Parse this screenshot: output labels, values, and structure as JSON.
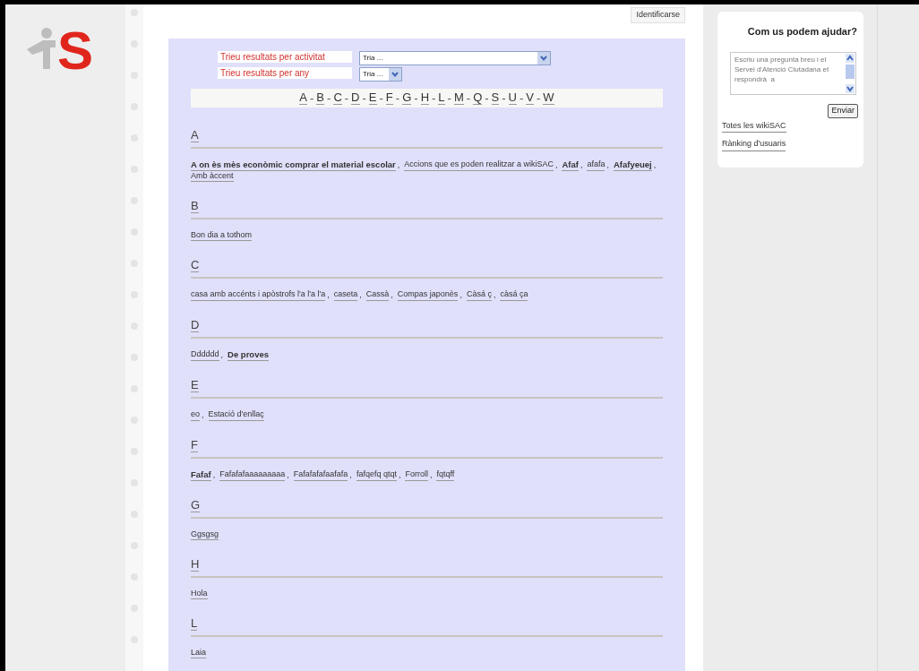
{
  "logo": {
    "text": "S"
  },
  "login_button": "Identificarse",
  "filters": [
    {
      "label": "Trieu resultats per activitat",
      "value": "Tria ...",
      "kind": "wide"
    },
    {
      "label": "Trieu resultats per any",
      "value": "Tria ...",
      "kind": "narrow"
    }
  ],
  "alphabet": [
    {
      "letter": "A",
      "suffix": "-"
    },
    {
      "letter": "B",
      "suffix": "-"
    },
    {
      "letter": "C",
      "suffix": "-"
    },
    {
      "letter": "D",
      "suffix": "-"
    },
    {
      "letter": "E",
      "suffix": "-"
    },
    {
      "letter": "F",
      "suffix": "-"
    },
    {
      "letter": "G",
      "suffix": "-"
    },
    {
      "letter": "H",
      "suffix": "-"
    },
    {
      "letter": "L",
      "suffix": "-"
    },
    {
      "letter": "M",
      "suffix": "-"
    },
    {
      "letter": "Q",
      "suffix": "-"
    },
    {
      "letter": "S",
      "suffix": "-"
    },
    {
      "letter": "U",
      "suffix": "-"
    },
    {
      "letter": "V",
      "suffix": "-"
    },
    {
      "letter": "W"
    }
  ],
  "sections": [
    {
      "letter": "A",
      "items": [
        {
          "text": "A on ès mès econòmic comprar el material escolar",
          "bold": true,
          "suffix": ","
        },
        {
          "text": "Accions que es poden realitzar a wikiSAC",
          "bold": false,
          "suffix": ","
        },
        {
          "text": "Afaf",
          "bold": true,
          "suffix": ","
        },
        {
          "text": "afafa",
          "bold": false,
          "suffix": ","
        },
        {
          "text": "Afafyeuej",
          "bold": true,
          "suffix": ","
        },
        {
          "text": "Amb àccent",
          "bold": false
        }
      ]
    },
    {
      "letter": "B",
      "items": [
        {
          "text": "Bon dia a tothom",
          "bold": false
        }
      ]
    },
    {
      "letter": "C",
      "items": [
        {
          "text": "casa amb accénts i apòstrofs l'a l'a l'a",
          "bold": false,
          "suffix": ","
        },
        {
          "text": "caseta",
          "bold": false,
          "suffix": ","
        },
        {
          "text": "Cassà",
          "bold": false,
          "suffix": ","
        },
        {
          "text": "Compas japonès",
          "bold": false,
          "suffix": ","
        },
        {
          "text": "Càsá ç",
          "bold": false,
          "suffix": ","
        },
        {
          "text": "càsá ça",
          "bold": false
        }
      ]
    },
    {
      "letter": "D",
      "items": [
        {
          "text": "Dddddd",
          "bold": false,
          "suffix": ","
        },
        {
          "text": "De proves",
          "bold": true
        }
      ]
    },
    {
      "letter": "E",
      "items": [
        {
          "text": "eo",
          "bold": false,
          "suffix": ","
        },
        {
          "text": "Estació d'enllaç",
          "bold": false
        }
      ]
    },
    {
      "letter": "F",
      "items": [
        {
          "text": "Fafaf",
          "bold": true,
          "suffix": ","
        },
        {
          "text": "Fafafafaaaaaaaaa",
          "bold": false,
          "suffix": ","
        },
        {
          "text": "Fafafafafaafafa",
          "bold": false,
          "suffix": ","
        },
        {
          "text": "fafqefq qtqt",
          "bold": false,
          "suffix": ","
        },
        {
          "text": "Forroll",
          "bold": false,
          "suffix": ","
        },
        {
          "text": "fqtqff",
          "bold": false
        }
      ]
    },
    {
      "letter": "G",
      "items": [
        {
          "text": "Ggsgsg",
          "bold": false
        }
      ]
    },
    {
      "letter": "H",
      "items": [
        {
          "text": "Hola",
          "bold": false
        }
      ]
    },
    {
      "letter": "L",
      "items": [
        {
          "text": "Laia",
          "bold": false
        }
      ]
    }
  ],
  "help": {
    "title": "Com us podem ajudar?",
    "placeholder": "Escriu una pregunta breu i el Servei d'Atenció Ciutadana et respondrà  a",
    "send_button": "Enviar",
    "links": [
      "Totes les wikiSAC",
      "Rànking d'usuaris"
    ]
  }
}
